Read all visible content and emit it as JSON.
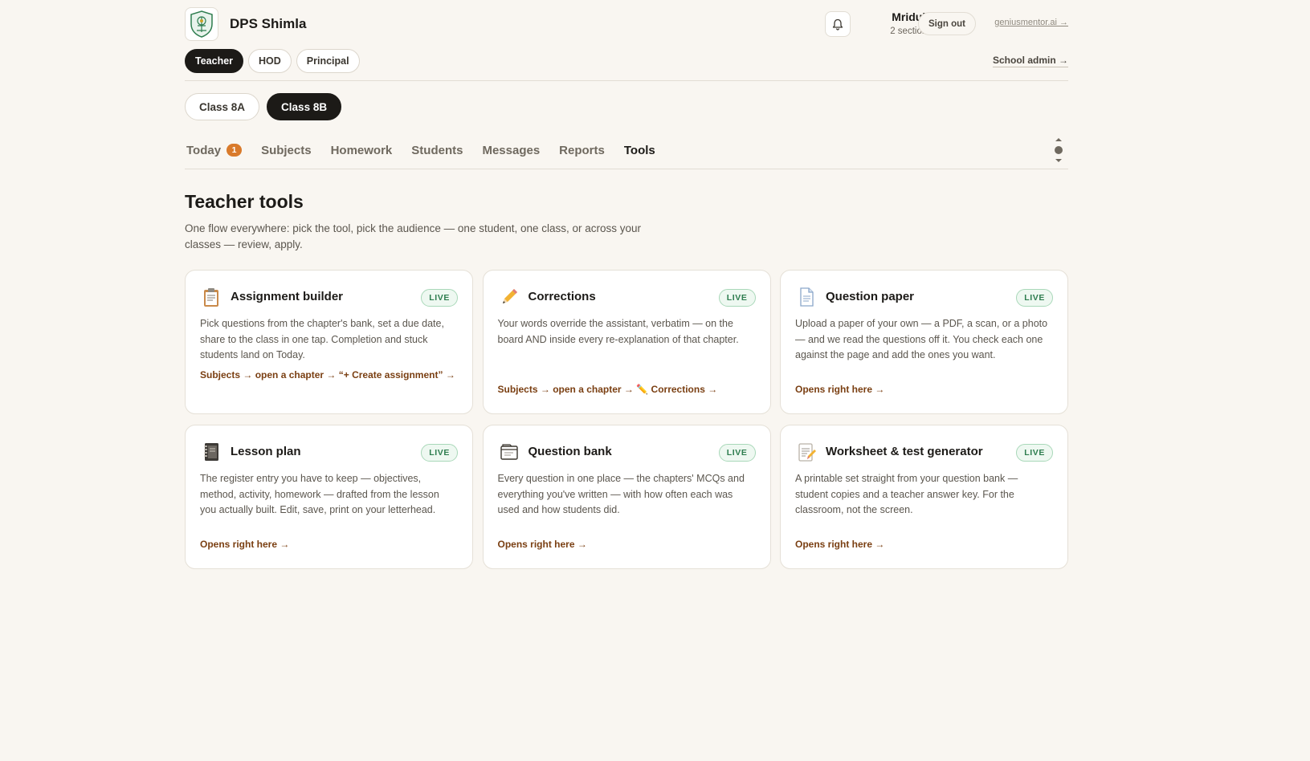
{
  "header": {
    "school_name": "DPS Shimla",
    "user_name": "Mridula",
    "user_sections": "2 sections",
    "signout_label": "Sign out",
    "external_link": "geniusmentor.ai →"
  },
  "roles": {
    "items": [
      "Teacher",
      "HOD",
      "Principal"
    ],
    "active": "Teacher",
    "admin_link": "School admin →"
  },
  "classes": {
    "items": [
      "Class 8A",
      "Class 8B"
    ],
    "active": "Class 8B"
  },
  "tabs": {
    "items": [
      {
        "label": "Today",
        "badge": "1"
      },
      {
        "label": "Subjects"
      },
      {
        "label": "Homework"
      },
      {
        "label": "Students"
      },
      {
        "label": "Messages"
      },
      {
        "label": "Reports"
      },
      {
        "label": "Tools"
      }
    ],
    "active": "Tools"
  },
  "section": {
    "title": "Teacher tools",
    "subtitle": "One flow everywhere: pick the tool, pick the audience — one student, one class, or across your classes — review, apply."
  },
  "cards": [
    {
      "icon": "clipboard-icon",
      "title": "Assignment builder",
      "status": "LIVE",
      "desc": "Pick questions from the chapter's bank, set a due date, share to the class in one tap. Completion and stuck students land on Today.",
      "link_parts": [
        "Subjects",
        "open a chapter",
        "“+ Create assignment”"
      ]
    },
    {
      "icon": "pencil-icon",
      "title": "Corrections",
      "status": "LIVE",
      "desc": "Your words override the assistant, verbatim — on the board AND inside every re-explanation of that chapter.",
      "link_parts": [
        "Subjects",
        "open a chapter",
        "✏️ Corrections"
      ]
    },
    {
      "icon": "page-icon",
      "title": "Question paper",
      "status": "LIVE",
      "desc": "Upload a paper of your own — a PDF, a scan, or a photo — and we read the questions off it. You check each one against the page and add the ones you want.",
      "link_parts": [
        "Opens right here"
      ]
    },
    {
      "icon": "notebook-icon",
      "title": "Lesson plan",
      "status": "LIVE",
      "desc": "The register entry you have to keep — objectives, method, activity, homework — drafted from the lesson you actually built. Edit, save, print on your letterhead.",
      "link_parts": [
        "Opens right here"
      ]
    },
    {
      "icon": "card-index-icon",
      "title": "Question bank",
      "status": "LIVE",
      "desc": "Every question in one place — the chapters' MCQs and everything you've written — with how often each was used and how students did.",
      "link_parts": [
        "Opens right here"
      ]
    },
    {
      "icon": "memo-icon",
      "title": "Worksheet & test generator",
      "status": "LIVE",
      "desc": "A printable set straight from your question bank — student copies and a teacher answer key. For the classroom, not the screen.",
      "link_parts": [
        "Opens right here"
      ]
    }
  ]
}
